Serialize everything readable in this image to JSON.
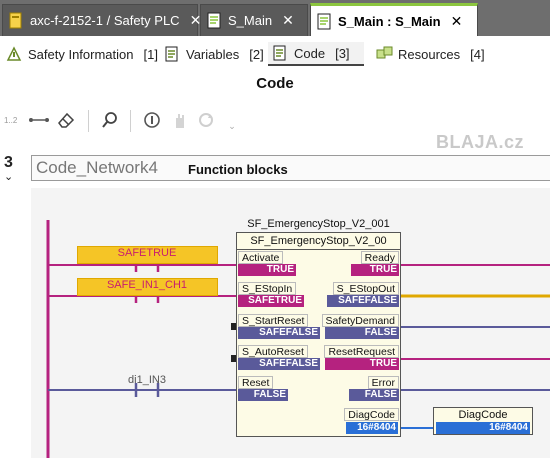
{
  "tabs": [
    {
      "label": "axc-f-2152-1 / Safety PLC",
      "close": "✕"
    },
    {
      "label": "S_Main",
      "close": "✕"
    },
    {
      "label": "S_Main : S_Main",
      "close": "✕"
    }
  ],
  "subtabs": [
    {
      "label": "Safety Information",
      "count": "[1]"
    },
    {
      "label": "Variables",
      "count": "[2]"
    },
    {
      "label": "Code",
      "count": "[3]"
    },
    {
      "label": "Resources",
      "count": "[4]"
    }
  ],
  "code_title": "Code",
  "toolbar": {
    "line_numbers": "1..2"
  },
  "network": {
    "number": "3",
    "chevron": "⌄",
    "name": "Code_Network4",
    "comment": "Function blocks"
  },
  "contacts": [
    {
      "label": "SAFETRUE"
    },
    {
      "label": "SAFE_IN1_CH1"
    },
    {
      "label": "di1_IN3"
    }
  ],
  "fb": {
    "instance": "SF_EmergencyStop_V2_001",
    "type": "SF_EmergencyStop_V2_00",
    "inputs": [
      {
        "name": "Activate",
        "value": "TRUE"
      },
      {
        "name": "S_EStopIn",
        "value": "SAFETRUE"
      },
      {
        "name": "S_StartReset",
        "value": "SAFEFALSE"
      },
      {
        "name": "S_AutoReset",
        "value": "SAFEFALSE"
      },
      {
        "name": "Reset",
        "value": "FALSE"
      }
    ],
    "outputs": [
      {
        "name": "Ready",
        "value": "TRUE"
      },
      {
        "name": "S_EStopOut",
        "value": "SAFEFALSE"
      },
      {
        "name": "SafetyDemand",
        "value": "FALSE"
      },
      {
        "name": "ResetRequest",
        "value": "TRUE"
      },
      {
        "name": "Error",
        "value": "FALSE"
      },
      {
        "name": "DiagCode",
        "value": "16#8404"
      }
    ]
  },
  "output_var": {
    "name": "DiagCode",
    "value": "16#8404"
  },
  "watermark": "BLAJA.cz",
  "colors": {
    "tab_accent": "#8cc63f",
    "contact": "#f5c526",
    "true_line": "#b5227f",
    "false_line": "#5a5a9a",
    "word_value": "#2a6fd6"
  }
}
